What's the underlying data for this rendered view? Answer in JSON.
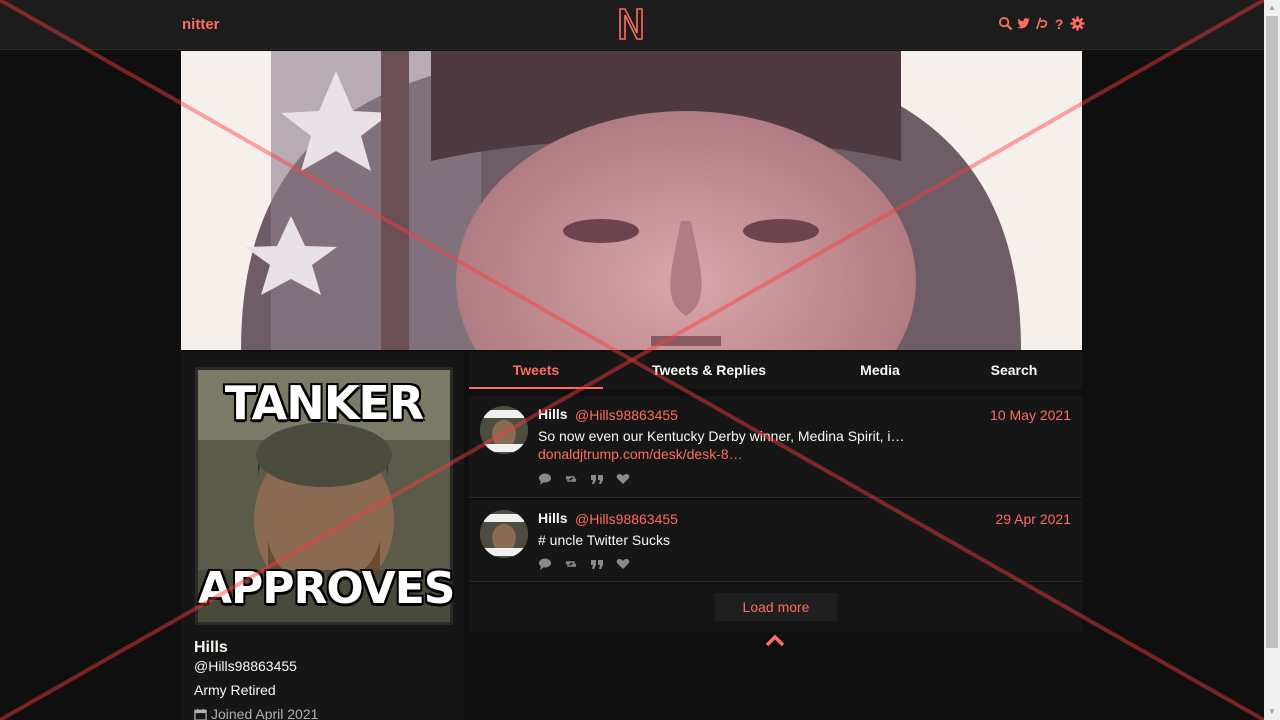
{
  "navbar": {
    "brand": "nitter",
    "logo_letter": "N",
    "icons": [
      "search-icon",
      "twitter-icon",
      "rss-icon",
      "help-icon",
      "gear-icon"
    ]
  },
  "banner": {
    "description": "banner-photo"
  },
  "profile": {
    "avatar_top_text": "TANKER",
    "avatar_bottom_text": "APPROVES",
    "fullname": "Hills",
    "username": "@Hills98863455",
    "bio": "Army Retired",
    "joined": "Joined April 2021"
  },
  "tabs": [
    {
      "label": "Tweets",
      "active": true
    },
    {
      "label": "Tweets & Replies",
      "active": false
    },
    {
      "label": "Media",
      "active": false
    },
    {
      "label": "Search",
      "active": false
    }
  ],
  "tweets": [
    {
      "name": "Hills",
      "handle": "@Hills98863455",
      "date": "10 May 2021",
      "text": "So now even our Kentucky Derby winner, Medina Spirit, i…",
      "link": "donaldjtrump.com/desk/desk-8…"
    },
    {
      "name": "Hills",
      "handle": "@Hills98863455",
      "date": "29 Apr 2021",
      "text": "# uncle Twitter Sucks",
      "link": ""
    }
  ],
  "load_more": "Load more",
  "colors": {
    "accent": "#ff6c60",
    "background": "#0f0f0f",
    "panel": "#161616",
    "navbar": "#1c1c1c"
  }
}
